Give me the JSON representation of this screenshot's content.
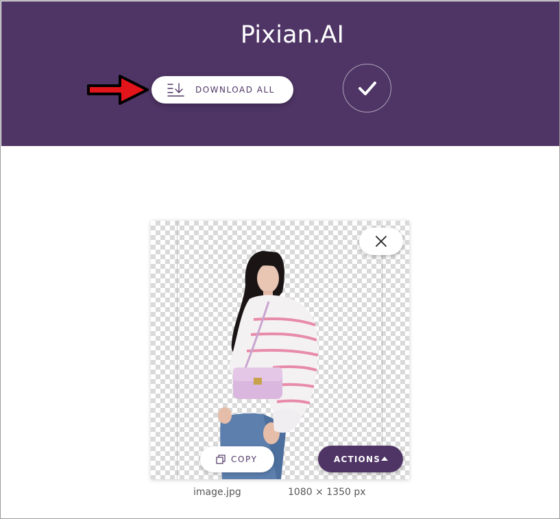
{
  "header": {
    "title": "Pixian.AI",
    "download_all_label": "DOWNLOAD ALL",
    "colors": {
      "background": "#4f3565",
      "title": "#ffffff"
    },
    "icons": {
      "download": "download-list-icon",
      "confirm": "checkmark-icon",
      "annotation": "red-arrow-icon"
    }
  },
  "result_card": {
    "copy_label": "COPY",
    "actions_label": "ACTIONS",
    "icons": {
      "close": "close-icon",
      "copy": "copy-icon",
      "actions": "caret-up-icon"
    },
    "colors": {
      "checker": "#d9d9d9",
      "accent": "#4f3565"
    }
  },
  "file_info": {
    "name": "image.jpg",
    "dimensions": "1080 × 1350 px"
  }
}
